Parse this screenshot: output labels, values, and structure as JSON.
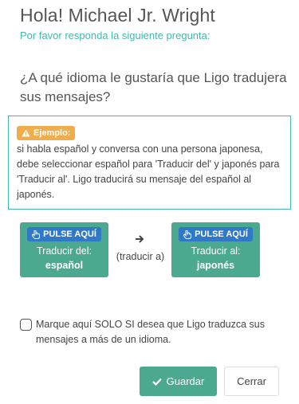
{
  "header": {
    "title": "Hola! Michael Jr. Wright",
    "subtitle": "Por favor responda la siguiente pregunta:"
  },
  "question": "¿A qué idioma le gustaría que Ligo tradujera sus mensajes?",
  "example": {
    "badge": "Ejemplo:",
    "badge_icon": "warning-icon",
    "text": "si habla español y conversa con una persona japonesa, debe seleccionar español para 'Traducir del' y japonés para 'Traducir al'. Ligo traducirá su mensaje del español al japonés."
  },
  "from_button": {
    "badge": "PULSE AQUÍ",
    "badge_icon": "hand-pointer-icon",
    "label": "Traducir del:",
    "value": "español"
  },
  "middle": {
    "arrow_icon": "arrow-right-icon",
    "text": "(traducir a)"
  },
  "to_button": {
    "badge": "PULSE AQUÍ",
    "badge_icon": "hand-pointer-icon",
    "label": "Traducir al:",
    "value": "japonés"
  },
  "multi_language": {
    "checked": false,
    "label": "Marque aquí SOLO SI desea que Ligo traduzca sus mensajes a más de un idioma."
  },
  "actions": {
    "save_label": "Guardar",
    "save_icon": "check-icon",
    "close_label": "Cerrar"
  },
  "colors": {
    "accent_teal": "#45b6b0",
    "button_green": "#4aa98f",
    "badge_blue": "#2f79c7",
    "warning_orange": "#f0ad4e"
  }
}
